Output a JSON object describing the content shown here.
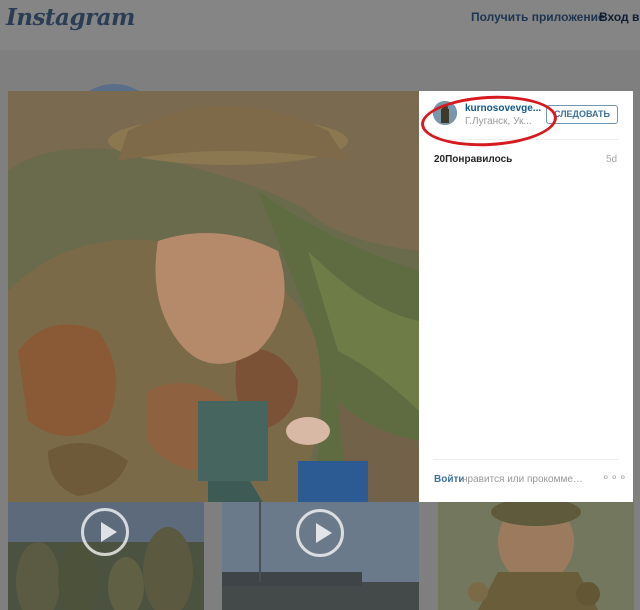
{
  "header": {
    "logo_text": "Instagram",
    "get_app_label": "Получить приложение",
    "login_label": "Вход в"
  },
  "post": {
    "username": "kurnosovevge...",
    "location": "Г.Луганск, Ук...",
    "follow_label": "СЛЕДОВАТЬ",
    "likes_text": "20Понравилось",
    "age_text": "5d",
    "footer_login_link": "Войти",
    "footer_text": "нравится или прокомменти...",
    "more_icon": "ellipsis-icon"
  },
  "annotation": {
    "color": "#d61a1f"
  },
  "thumbnails": [
    {
      "has_play_icon": true
    },
    {
      "has_play_icon": true
    },
    {
      "has_play_icon": false
    }
  ],
  "colors": {
    "link": "#125688",
    "follow_border": "#6f97b6",
    "overlay_bg": "#7f7f7f"
  }
}
